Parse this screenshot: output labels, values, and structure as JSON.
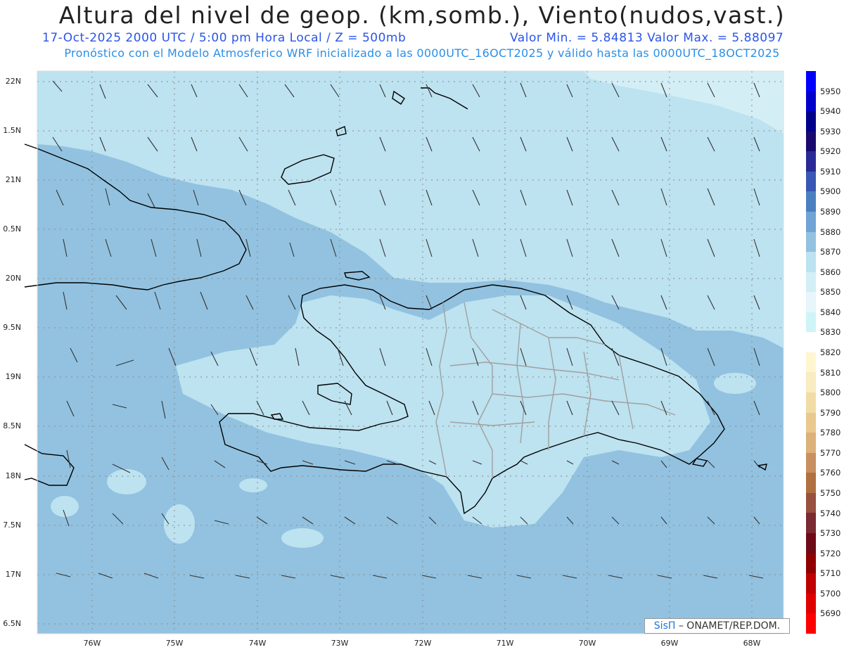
{
  "header": {
    "title": "Altura del nivel de geop. (km,somb.), Viento(nudos,vast.)",
    "subtitle_left": "17-Oct-2025   2000 UTC / 5:00 pm Hora Local / Z = 500mb",
    "subtitle_right": "Valor Min. = 5.84813   Valor Max. = 5.88097",
    "subtitle_2": "Pronóstico con el Modelo Atmosferico WRF inicializado a las 0000UTC_16OCT2025 y válido hasta las  0000UTC_18OCT2025"
  },
  "axes": {
    "lat_labels": [
      "22N",
      "1.5N",
      "21N",
      "0.5N",
      "20N",
      "9.5N",
      "19N",
      "8.5N",
      "18N",
      "7.5N",
      "17N",
      "6.5N"
    ],
    "lon_labels": [
      "76W",
      "75W",
      "74W",
      "73W",
      "72W",
      "71W",
      "70W",
      "69W",
      "68W"
    ]
  },
  "legend": {
    "labels": [
      "5950",
      "5940",
      "5930",
      "5920",
      "5910",
      "5900",
      "5890",
      "5880",
      "5870",
      "5860",
      "5850",
      "5840",
      "5830",
      "5820",
      "5810",
      "5800",
      "5790",
      "5780",
      "5770",
      "5760",
      "5750",
      "5740",
      "5730",
      "5720",
      "5710",
      "5700",
      "5690"
    ],
    "colors": [
      "#0000ff",
      "#0000cc",
      "#00008b",
      "#1a0a6e",
      "#2a2a96",
      "#3858b4",
      "#4a80c0",
      "#70a4d4",
      "#92c2e0",
      "#bde2f0",
      "#d4eef6",
      "#e6f6fa",
      "#cff4f8",
      "#ffffff",
      "#fff6d0",
      "#f9ebc2",
      "#f2dca6",
      "#e9c98d",
      "#dcb17a",
      "#c89060",
      "#b07040",
      "#985040",
      "#7a2a30",
      "#6e0a18",
      "#900000",
      "#c00000",
      "#e00000",
      "#ff0000"
    ],
    "top_color_band": "#0000ff"
  },
  "map": {
    "ocean_color": "#92c2e0",
    "light_color": "#bde2f0",
    "lightest_color": "#d4eef6",
    "coast_color": "#000000",
    "border_color": "#a0a0a0",
    "grid_color": "#8a8a8a"
  },
  "credit": {
    "sis": "SisΠ",
    "text": "– ONAMET/REP.DOM."
  }
}
